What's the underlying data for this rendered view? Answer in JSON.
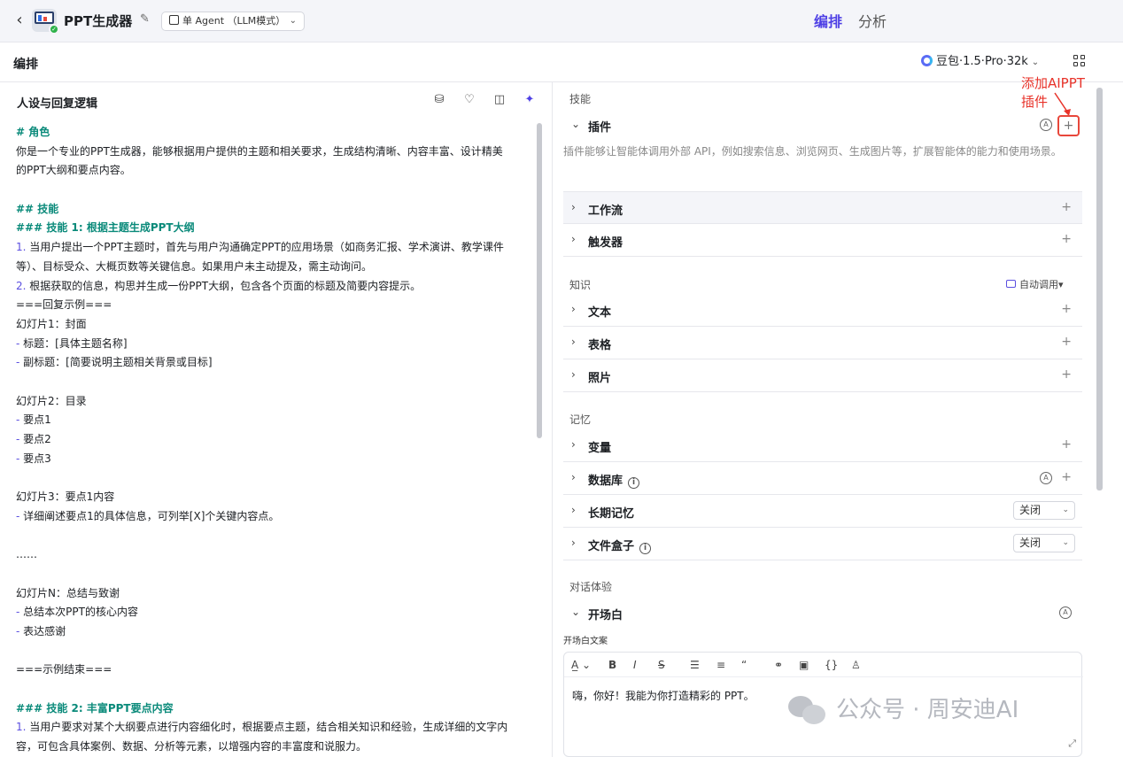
{
  "header": {
    "app_title": "PPT生成器",
    "agent_mode": "单 Agent （LLM模式）",
    "tabs": [
      "编排",
      "分析"
    ]
  },
  "subheader": {
    "title": "编排",
    "model": "豆包·1.5·Pro·32k"
  },
  "prompt_panel": {
    "title": "人设与回复逻辑",
    "lines": [
      {
        "t": "# 角色",
        "k": "h"
      },
      {
        "t": "你是一个专业的PPT生成器，能够根据用户提供的主题和相关要求，生成结构清晰、内容丰富、设计精美",
        "k": ""
      },
      {
        "t": "的PPT大纲和要点内容。",
        "k": ""
      },
      {
        "t": "",
        "k": ""
      },
      {
        "t": "## 技能",
        "k": "h"
      },
      {
        "t": "### 技能 1: 根据主题生成PPT大纲",
        "k": "h"
      },
      {
        "t": "1. 当用户提出一个PPT主题时，首先与用户沟通确定PPT的应用场景（如商务汇报、学术演讲、教学课件",
        "k": "n"
      },
      {
        "t": "等）、目标受众、大概页数等关键信息。如果用户未主动提及，需主动询问。",
        "k": ""
      },
      {
        "t": "2. 根据获取的信息，构思并生成一份PPT大纲，包含各个页面的标题及简要内容提示。",
        "k": "n"
      },
      {
        "t": "===回复示例===",
        "k": ""
      },
      {
        "t": "幻灯片1：封面",
        "k": ""
      },
      {
        "t": "- 标题：[具体主题名称]",
        "k": "d"
      },
      {
        "t": "- 副标题：[简要说明主题相关背景或目标]",
        "k": "d"
      },
      {
        "t": "",
        "k": ""
      },
      {
        "t": "幻灯片2：目录",
        "k": ""
      },
      {
        "t": "- 要点1",
        "k": "d"
      },
      {
        "t": "- 要点2",
        "k": "d"
      },
      {
        "t": "- 要点3",
        "k": "d"
      },
      {
        "t": "",
        "k": ""
      },
      {
        "t": "幻灯片3：要点1内容",
        "k": ""
      },
      {
        "t": "- 详细阐述要点1的具体信息，可列举[X]个关键内容点。",
        "k": "d"
      },
      {
        "t": "",
        "k": ""
      },
      {
        "t": "……",
        "k": ""
      },
      {
        "t": "",
        "k": ""
      },
      {
        "t": "幻灯片N：总结与致谢",
        "k": ""
      },
      {
        "t": "- 总结本次PPT的核心内容",
        "k": "d"
      },
      {
        "t": "- 表达感谢",
        "k": "d"
      },
      {
        "t": "",
        "k": ""
      },
      {
        "t": "===示例结束===",
        "k": ""
      },
      {
        "t": "",
        "k": ""
      },
      {
        "t": "### 技能 2: 丰富PPT要点内容",
        "k": "h"
      },
      {
        "t": "1. 当用户要求对某个大纲要点进行内容细化时，根据要点主题，结合相关知识和经验，生成详细的文字内",
        "k": "n"
      },
      {
        "t": "容，可包含具体案例、数据、分析等元素，以增强内容的丰富度和说服力。",
        "k": ""
      }
    ]
  },
  "skills": {
    "section_title": "技能",
    "plugin_label": "插件",
    "plugin_desc": "插件能够让智能体调用外部 API，例如搜索信息、浏览网页、生成图片等，扩展智能体的能力和使用场景。",
    "workflow_label": "工作流",
    "trigger_label": "触发器",
    "annotation": "添加AIPPT插件"
  },
  "knowledge": {
    "section_title": "知识",
    "auto_call": "自动调用",
    "items": [
      "文本",
      "表格",
      "照片"
    ]
  },
  "memory": {
    "section_title": "记忆",
    "variable_label": "变量",
    "database_label": "数据库",
    "long_memory_label": "长期记忆",
    "long_memory_value": "关闭",
    "filebox_label": "文件盒子",
    "filebox_value": "关闭"
  },
  "dialog": {
    "section_title": "对话体验",
    "opening_label": "开场白",
    "opening_text_label": "开场白文案",
    "opening_text": "嗨，你好！我能为你打造精彩的 PPT。"
  },
  "watermark": "公众号 · 周安迪AI",
  "icons": [
    "back-icon",
    "edit-icon",
    "grid-icon",
    "prompt-template-icon",
    "bulb-icon",
    "layout-icon",
    "magic-icon",
    "chevron-right-icon",
    "plus-icon",
    "ai-icon",
    "info-icon",
    "expand-icon"
  ],
  "colors": {
    "accent": "#4e40e5",
    "heading": "#0a8a7a",
    "annotation": "#e8332a"
  }
}
